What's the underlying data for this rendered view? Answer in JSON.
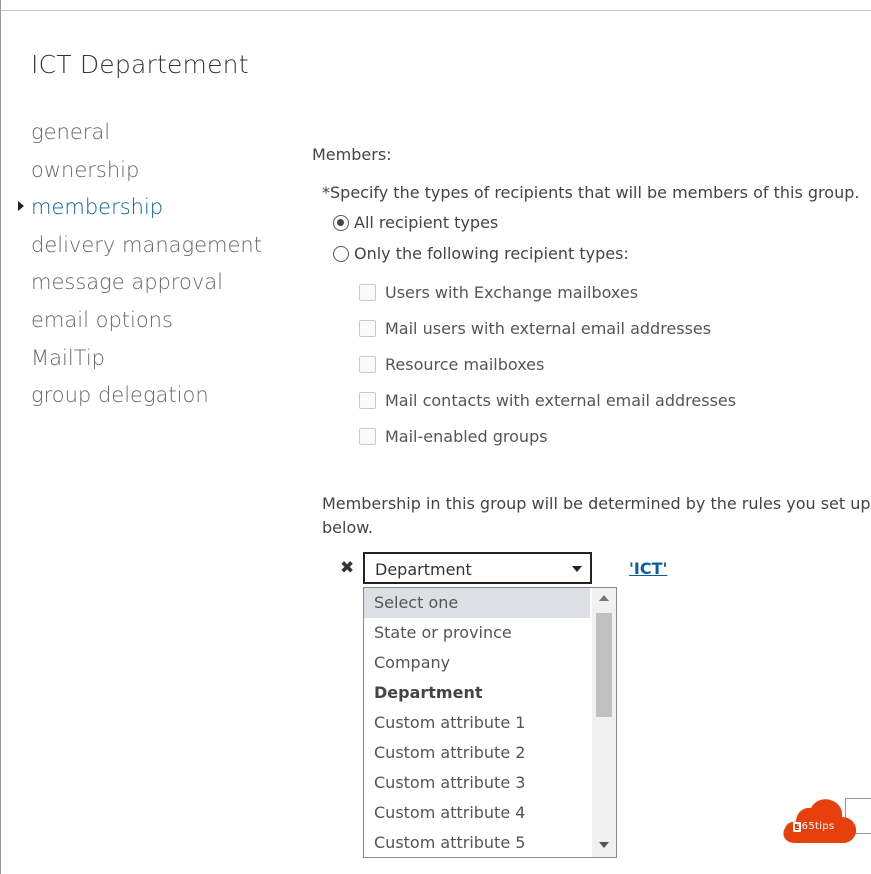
{
  "page": {
    "title": "ICT Departement"
  },
  "nav": {
    "items": [
      {
        "label": "general",
        "active": false
      },
      {
        "label": "ownership",
        "active": false
      },
      {
        "label": "membership",
        "active": true
      },
      {
        "label": "delivery management",
        "active": false
      },
      {
        "label": "message approval",
        "active": false
      },
      {
        "label": "email options",
        "active": false
      },
      {
        "label": "MailTip",
        "active": false
      },
      {
        "label": "group delegation",
        "active": false
      }
    ]
  },
  "membership": {
    "members_label": "Members:",
    "spec_text": "*Specify the types of recipients that will be members of this group.",
    "radio_all": {
      "label": "All recipient types",
      "checked": true
    },
    "radio_only": {
      "label": "Only the following recipient types:",
      "checked": false
    },
    "checkboxes": [
      {
        "label": "Users with Exchange mailboxes",
        "checked": false
      },
      {
        "label": "Mail users with external email addresses",
        "checked": false
      },
      {
        "label": "Resource mailboxes",
        "checked": false
      },
      {
        "label": "Mail contacts with external email addresses",
        "checked": false
      },
      {
        "label": "Mail-enabled groups",
        "checked": false
      }
    ],
    "rules_text": "Membership in this group will be determined by the rules you set up below.",
    "rule": {
      "remove_glyph": "✖",
      "attribute_selected": "Department",
      "value_link": "'ICT'"
    },
    "dropdown_options": [
      {
        "label": "Select one",
        "state": "hover"
      },
      {
        "label": "State or province",
        "state": ""
      },
      {
        "label": "Company",
        "state": ""
      },
      {
        "label": "Department",
        "state": "selected"
      },
      {
        "label": "Custom attribute 1",
        "state": ""
      },
      {
        "label": "Custom attribute 2",
        "state": ""
      },
      {
        "label": "Custom attribute 3",
        "state": ""
      },
      {
        "label": "Custom attribute 4",
        "state": ""
      },
      {
        "label": "Custom attribute 5",
        "state": ""
      }
    ]
  },
  "watermark": {
    "text": "365tips",
    "color": "#e8400c"
  },
  "colors": {
    "accent": "#0c5d9e",
    "nav_text": "#666666",
    "hover_bg": "#dcdfe3"
  }
}
